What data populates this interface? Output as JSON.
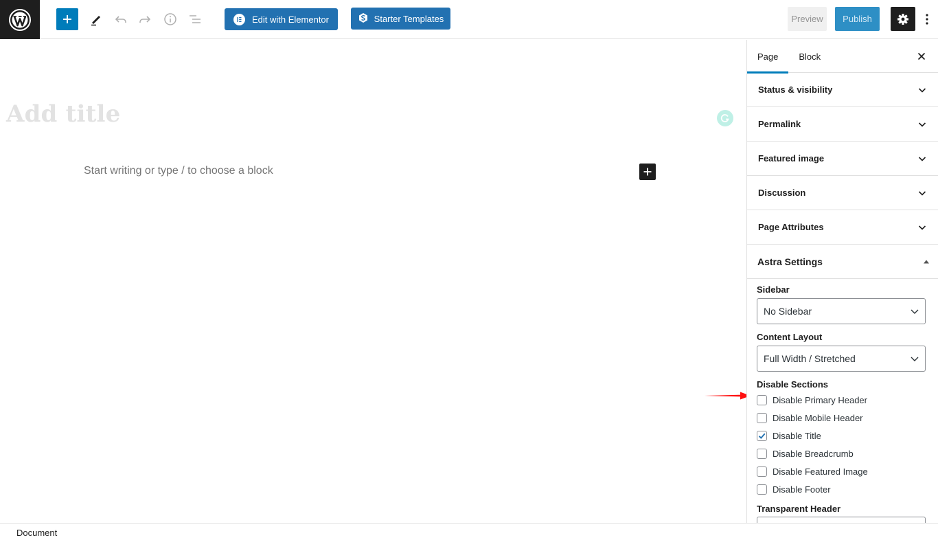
{
  "toolbar": {
    "edit_elementor_label": "Edit with Elementor",
    "starter_templates_label": "Starter Templates",
    "preview_label": "Preview",
    "publish_label": "Publish",
    "icons": [
      "wordpress-logo-icon",
      "plus-icon",
      "pencil-icon",
      "undo-icon",
      "redo-icon",
      "info-icon",
      "list-view-icon",
      "elementor-icon",
      "starter-templates-icon",
      "gear-icon",
      "more-vertical-icon"
    ],
    "accent_color": "#007cba"
  },
  "editor": {
    "title_placeholder": "Add title",
    "block_placeholder": "Start writing or type / to choose a block"
  },
  "sidebar": {
    "tabs": [
      {
        "label": "Page",
        "active": true
      },
      {
        "label": "Block",
        "active": false
      }
    ],
    "panels": [
      {
        "label": "Status & visibility"
      },
      {
        "label": "Permalink"
      },
      {
        "label": "Featured image"
      },
      {
        "label": "Discussion"
      },
      {
        "label": "Page Attributes"
      }
    ],
    "astra": {
      "title": "Astra Settings",
      "sidebar_label": "Sidebar",
      "sidebar_value": "No Sidebar",
      "content_layout_label": "Content Layout",
      "content_layout_value": "Full Width / Stretched",
      "disable_sections_label": "Disable Sections",
      "checkboxes": [
        {
          "label": "Disable Primary Header",
          "checked": false
        },
        {
          "label": "Disable Mobile Header",
          "checked": false
        },
        {
          "label": "Disable Title",
          "checked": true
        },
        {
          "label": "Disable Breadcrumb",
          "checked": false
        },
        {
          "label": "Disable Featured Image",
          "checked": false
        },
        {
          "label": "Disable Footer",
          "checked": false
        }
      ],
      "transparent_header_label": "Transparent Header"
    }
  },
  "footer": {
    "breadcrumb": "Document"
  }
}
